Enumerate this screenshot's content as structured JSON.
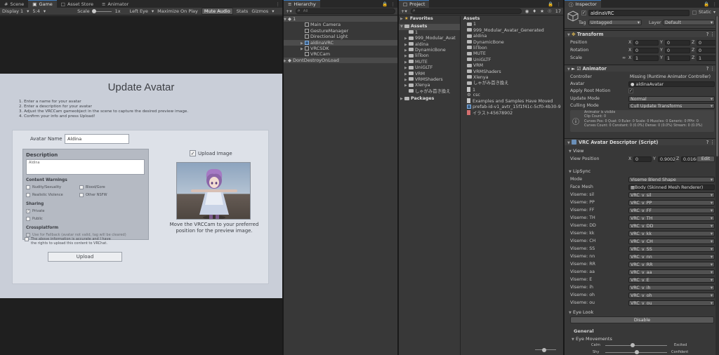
{
  "game": {
    "tabs": [
      "Scene",
      "Game",
      "Asset Store",
      "Animator"
    ],
    "display": "Display 1",
    "aspect": "5:4",
    "scale_label": "Scale",
    "scale_value": "1x",
    "eye": "Left Eye",
    "maximize": "Maximize On Play",
    "mute": "Mute Audio",
    "stats": "Stats",
    "gizmos": "Gizmos"
  },
  "upload": {
    "title": "Update Avatar",
    "steps": [
      "1. Enter a name for your avatar",
      "2. Enter a description for your avatar",
      "3. Adjust the VRCCam gameobject in the scene to capture the desired preview image.",
      "4. Confirm your info and press Upload!"
    ],
    "avatar_name_label": "Avatar Name",
    "avatar_name_value": "Aldina",
    "description_label": "Description",
    "description_value": "Aldina",
    "content_warnings_label": "Content Warnings",
    "warnings": [
      "Nudity/Sexuality",
      "Blood/Gore",
      "Realistic Violence",
      "Other NSFW"
    ],
    "sharing_label": "Sharing",
    "sharing": [
      "Private",
      "Public"
    ],
    "crossplatform_label": "Crossplatform",
    "fallback": "Use for Fallback (avatar not valid, tag will be cleared)",
    "upload_image_label": "Upload Image",
    "preview_hint": "Move the VRCCam to your preferred position for the preview image.",
    "agree": "The above information is accurate and I have the rights to upload this content to VRChat.",
    "upload_button": "Upload"
  },
  "hierarchy": {
    "tab": "Hierarchy",
    "search_placeholder": "All",
    "scene": "1",
    "items": [
      "Main Camera",
      "GestureManager",
      "Directional Light",
      "aldinaVRC",
      "VRCSDK",
      "VRCCam"
    ],
    "dontdestroy": "DontDestroyOnLoad"
  },
  "project": {
    "tab": "Project",
    "favorites": "Favorites",
    "assets": "Assets",
    "tree": [
      "1",
      "999_Modular_Avat",
      "aldina",
      "DynamicBone",
      "lilToon",
      "MUTE",
      "UniGLTF",
      "VRM",
      "VRMShaders",
      "Xlenya",
      "しゃがみ首き換え"
    ],
    "packages": "Packages",
    "assets_header": "Assets",
    "files": [
      "1",
      "999_Modular_Avatar_Generated",
      "aldina",
      "DynamicBone",
      "lilToon",
      "MUTE",
      "UniGLTF",
      "VRM",
      "VRMShaders",
      "Xlenya",
      "しゃがみ首き換え",
      "1",
      "csc",
      "Examples and Samples Have Moved",
      "prefab-id-v1_avtr_15f1f41c-5cf0-4b30-9",
      "イラスト45678902"
    ],
    "count": "17"
  },
  "inspector": {
    "tab": "Inspector",
    "object_name": "aldinaVRC",
    "static": "Static",
    "tag_label": "Tag",
    "tag_value": "Untagged",
    "layer_label": "Layer",
    "layer_value": "Default",
    "transform": {
      "title": "Transform",
      "rows": [
        {
          "label": "Position",
          "x": "0",
          "y": "0",
          "z": "0"
        },
        {
          "label": "Rotation",
          "x": "0",
          "y": "0",
          "z": "0"
        },
        {
          "label": "Scale",
          "x": "1",
          "y": "1",
          "z": "1"
        }
      ]
    },
    "animator": {
      "title": "Animator",
      "controller_label": "Controller",
      "controller_value": "Missing (Runtime Animator Controller)",
      "avatar_label": "Avatar",
      "avatar_value": "aldinaAvatar",
      "root_motion_label": "Apply Root Motion",
      "update_mode_label": "Update Mode",
      "update_mode_value": "Normal",
      "culling_label": "Culling Mode",
      "culling_value": "Cull Update Transforms",
      "info": [
        "Animator is visible",
        "Clip Count: 0",
        "Curves Pos: 0 Quat: 0 Euler: 0 Scale: 0 Muscles: 0 Generic: 0 PPtr: 0",
        "Curves Count: 0 Constant: 0 (0.0%) Dense: 0 (0.0%) Stream: 0 (0.0%)"
      ]
    },
    "descriptor": {
      "title": "VRC Avatar Descriptor (Script)",
      "view_label": "View",
      "view_position_label": "View Position",
      "vx": "0",
      "vy": "0.9002",
      "vz": "0.0168",
      "edit": "Edit",
      "lipsync_label": "LipSync",
      "mode_label": "Mode",
      "mode_value": "Viseme Blend Shape",
      "face_mesh_label": "Face Mesh",
      "face_mesh_value": "Body (Skinned Mesh Renderer)",
      "visemes": [
        {
          "label": "Viseme: sil",
          "value": "VRC_v_sil"
        },
        {
          "label": "Viseme: PP",
          "value": "VRC_v_PP"
        },
        {
          "label": "Viseme: FF",
          "value": "VRC_v_FF"
        },
        {
          "label": "Viseme: TH",
          "value": "VRC_v_TH"
        },
        {
          "label": "Viseme: DD",
          "value": "VRC_v_DD"
        },
        {
          "label": "Viseme: kk",
          "value": "VRC_v_kk"
        },
        {
          "label": "Viseme: CH",
          "value": "VRC_v_CH"
        },
        {
          "label": "Viseme: SS",
          "value": "VRC_v_SS"
        },
        {
          "label": "Viseme: nn",
          "value": "VRC_v_nn"
        },
        {
          "label": "Viseme: RR",
          "value": "VRC_v_RR"
        },
        {
          "label": "Viseme: aa",
          "value": "VRC_v_aa"
        },
        {
          "label": "Viseme: E",
          "value": "VRC_v_E"
        },
        {
          "label": "Viseme: ih",
          "value": "VRC_v_ih"
        },
        {
          "label": "Viseme: oh",
          "value": "VRC_v_oh"
        },
        {
          "label": "Viseme: ou",
          "value": "VRC_v_ou"
        }
      ],
      "eye_look_label": "Eye Look",
      "disable": "Disable",
      "general_label": "General",
      "eye_movements_label": "Eye Movements",
      "calm": "Calm",
      "excited": "Excited",
      "shy": "Shy",
      "confident": "Confident"
    }
  }
}
